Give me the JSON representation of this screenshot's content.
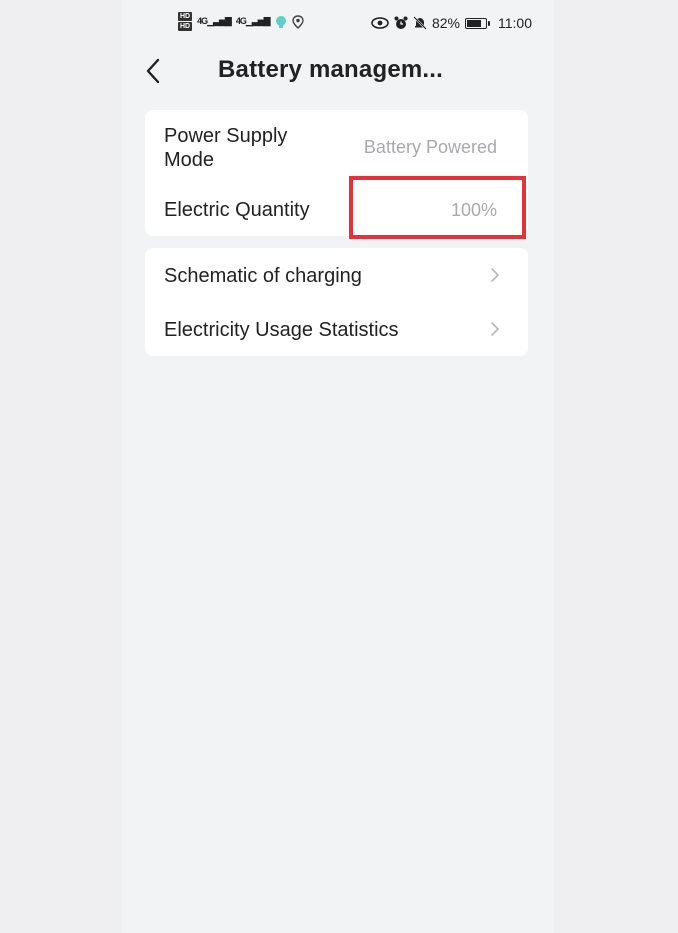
{
  "status_bar": {
    "hd1": "HD",
    "hd2": "HD",
    "signal1": "4G",
    "signal2": "4G",
    "battery_percent_text": "82%",
    "battery_level": 0.82,
    "time": "11:00",
    "icons": [
      "hd-icon",
      "signal-icon",
      "signal-icon",
      "app-notification-icon",
      "location-icon",
      "eye-icon",
      "alarm-icon",
      "mute-bell-icon",
      "battery-icon"
    ]
  },
  "header": {
    "title": "Battery managem...",
    "back_icon": "chevron-left-icon"
  },
  "card1": {
    "power_supply_label": "Power Supply Mode",
    "power_supply_value": "Battery Powered",
    "electric_quantity_label": "Electric Quantity",
    "electric_quantity_value": "100%"
  },
  "card2": {
    "items": [
      {
        "label": "Schematic of charging",
        "icon": "chevron-right-icon"
      },
      {
        "label": "Electricity Usage Statistics",
        "icon": "chevron-right-icon"
      }
    ]
  },
  "annotation": {
    "highlight_color": "#e53238",
    "highlight_target": "electric-quantity-value"
  }
}
